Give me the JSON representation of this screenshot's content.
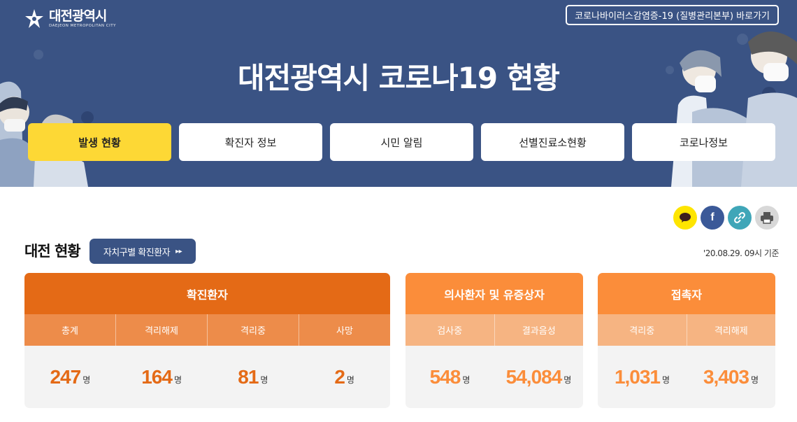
{
  "logo": {
    "name_kr": "대전광역시",
    "name_en": "DAEJEON METROPOLITAN CITY"
  },
  "top_link": "코로나바이러스감염증-19 (질병관리본부) 바로가기",
  "title": "대전광역시 코로나19 현황",
  "tabs": [
    {
      "label": "발생 현황",
      "active": true
    },
    {
      "label": "확진자 정보",
      "active": false
    },
    {
      "label": "시민 알림",
      "active": false
    },
    {
      "label": "선별진료소현황",
      "active": false
    },
    {
      "label": "코로나정보",
      "active": false
    }
  ],
  "share": {
    "icons": [
      "kakao-icon",
      "facebook-icon",
      "link-icon",
      "print-icon"
    ],
    "facebook_letter": "f"
  },
  "section": {
    "title": "대전 현황",
    "button_label": "자치구별 확진환자",
    "button_arrow": "▸▸",
    "date": "'20.08.29. 09시 기준"
  },
  "cards": {
    "confirmed": {
      "title": "확진환자",
      "columns": [
        {
          "label": "총계",
          "value": "247",
          "unit": "명"
        },
        {
          "label": "격리해제",
          "value": "164",
          "unit": "명"
        },
        {
          "label": "격리중",
          "value": "81",
          "unit": "명"
        },
        {
          "label": "사망",
          "value": "2",
          "unit": "명"
        }
      ]
    },
    "suspected": {
      "title": "의사환자 및 유증상자",
      "columns": [
        {
          "label": "검사중",
          "value": "548",
          "unit": "명"
        },
        {
          "label": "결과음성",
          "value": "54,084",
          "unit": "명"
        }
      ]
    },
    "contacts": {
      "title": "접촉자",
      "columns": [
        {
          "label": "격리중",
          "value": "1,031",
          "unit": "명"
        },
        {
          "label": "격리해제",
          "value": "3,403",
          "unit": "명"
        }
      ]
    }
  },
  "colors": {
    "header_bg": "#3a5384",
    "active_tab": "#fdd835",
    "confirmed_orange": "#e46a16",
    "light_orange": "#fb8d3a"
  }
}
